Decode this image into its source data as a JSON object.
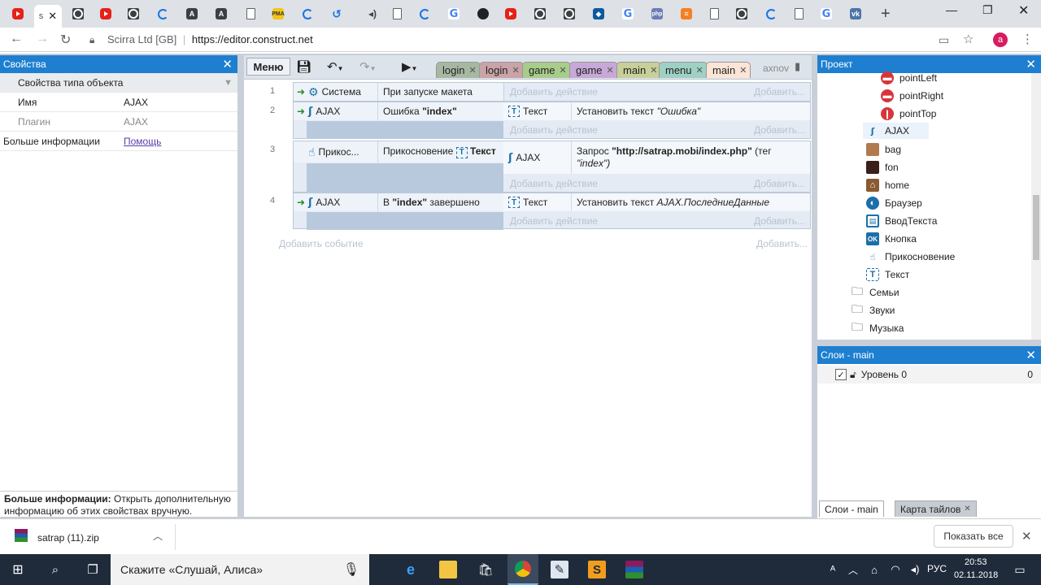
{
  "browser": {
    "url_site": "Scirra Ltd [GB]",
    "url": "https://editor.construct.net",
    "avatar_letter": "a",
    "active_tab_label": "s"
  },
  "editor": {
    "properties": {
      "title": "Свойства",
      "section": "Свойства типа объекта",
      "rows": [
        {
          "key": "Имя",
          "value": "AJAX"
        },
        {
          "key": "Плагин",
          "value": "AJAX"
        }
      ],
      "more_label": "Больше информации",
      "more_link": "Помощь",
      "help_bold": "Больше информации:",
      "help_text": " Открыть дополнительную информацию об этих свойствах вручную."
    },
    "toolbar": {
      "menu_label": "Меню",
      "tabs": [
        {
          "label": "login",
          "color": "#a7b8a2"
        },
        {
          "label": "login",
          "color": "#c9a3a8"
        },
        {
          "label": "game",
          "color": "#a8cc8a"
        },
        {
          "label": "game",
          "color": "#c8a8d8"
        },
        {
          "label": "main",
          "color": "#c8cf98"
        },
        {
          "label": "menu",
          "color": "#9fd0c4"
        },
        {
          "label": "main",
          "color": "#fce5d6"
        }
      ],
      "user": "axnov"
    },
    "events": [
      {
        "num": "1",
        "obj": "Система",
        "cond": "При запуске макета",
        "add_action": "Добавить действие",
        "add_right": "Добавить..."
      },
      {
        "num": "2",
        "obj": "AJAX",
        "cond_pre": "Ошибка ",
        "cond_bold": "\"index\"",
        "act_obj": "Текст",
        "act_pre": "Установить текст ",
        "act_italic": "\"Ошибка\"",
        "add_action": "Добавить действие",
        "add_right": "Добавить..."
      },
      {
        "num": "3",
        "obj": "Прикос...",
        "cond_pre": "Прикосновение ",
        "cond_bold": "Текст",
        "act_obj": "AJAX",
        "act_pre": "Запрос ",
        "act_bold": "\"http://satrap.mobi/index.php\"",
        "act_post": " (тег",
        "act_line2": "\"index\")",
        "add_action": "Добавить действие",
        "add_right": "Добавить..."
      },
      {
        "num": "4",
        "obj": "AJAX",
        "cond_pre": "В ",
        "cond_bold": "\"index\"",
        "cond_post": " завершено",
        "act_obj": "Текст",
        "act_pre": "Установить текст ",
        "act_italic": "AJAX.ПоследниеДанные",
        "add_action": "Добавить действие",
        "add_right": "Добавить..."
      }
    ],
    "add_event": "Добавить событие",
    "add_event_right": "Добавить...",
    "project": {
      "title": "Проект",
      "items": [
        {
          "label": "pointLeft",
          "icon": "red-circle-icon"
        },
        {
          "label": "pointRight",
          "icon": "red-circle-icon"
        },
        {
          "label": "pointTop",
          "icon": "red-circle-icon"
        },
        {
          "label": "AJAX",
          "icon": "ajax-icon"
        },
        {
          "label": "bag",
          "icon": "bag-sprite-icon"
        },
        {
          "label": "fon",
          "icon": "fon-sprite-icon"
        },
        {
          "label": "home",
          "icon": "home-sprite-icon"
        },
        {
          "label": "Браузер",
          "icon": "browser-globe-icon"
        },
        {
          "label": "ВводТекста",
          "icon": "textbox-icon"
        },
        {
          "label": "Кнопка",
          "icon": "button-ok-icon"
        },
        {
          "label": "Прикосновение",
          "icon": "touch-icon"
        },
        {
          "label": "Текст",
          "icon": "text-object-icon"
        }
      ],
      "folders": [
        "Семьи",
        "Звуки",
        "Музыка"
      ]
    },
    "layers": {
      "title": "Слои - main",
      "layer_name": "Уровень 0",
      "layer_count": "0",
      "tab1": "Слои - main",
      "tab2": "Карта тайлов"
    }
  },
  "downloads": {
    "file": "satrap (11).zip",
    "show_all": "Показать все"
  },
  "taskbar": {
    "search": "Скажите «Слушай, Алиса»",
    "lang": "РУС",
    "time": "20:53",
    "date": "02.11.2018"
  }
}
